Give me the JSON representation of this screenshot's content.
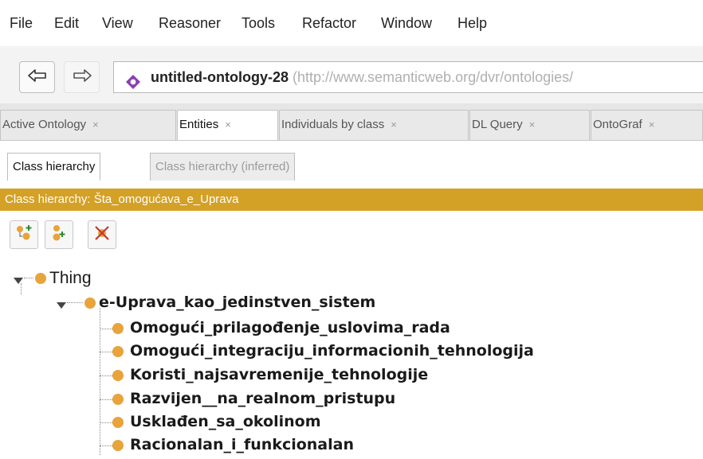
{
  "menu": [
    "File",
    "Edit",
    "View",
    "Reasoner",
    "Tools",
    "Refactor",
    "Window",
    "Help"
  ],
  "nav": {
    "back_icon": "back-arrow-icon",
    "forward_icon": "forward-arrow-icon",
    "ontology_icon": "ontology-diamond-icon",
    "ontology_name": "untitled-ontology-28",
    "ontology_url": "(http://www.semanticweb.org/dvr/ontologies/"
  },
  "workspace_tabs": [
    {
      "label": "Active Ontology",
      "close": "×"
    },
    {
      "label": "Entities",
      "close": "×"
    },
    {
      "label": "Individuals by class",
      "close": "×"
    },
    {
      "label": "DL Query",
      "close": "×"
    },
    {
      "label": "OntoGraf",
      "close": "×"
    }
  ],
  "sub_tabs": [
    "Class hierarchy",
    "Class hierarchy (inferred)"
  ],
  "view_header": "Class hierarchy: Šta_omogućava_e_Uprava",
  "toolbar": {
    "add_subclass_icon": "add-subclass-icon",
    "add_sibling_icon": "add-sibling-icon",
    "delete_class_icon": "delete-class-icon"
  },
  "tree": {
    "root": "Thing",
    "parent": "e-Uprava_kao_jedinstven_sistem",
    "children": [
      "Omogući_prilagođenje_uslovima_rada",
      "Omogući_integraciju_informacionih_tehnologija",
      "Koristi_najsavremenije_tehnologije",
      "Razvijen__na_realnom_pristupu",
      "Usklađen_sa_okolinom",
      "Racionalan_i_funkcionalan"
    ]
  },
  "colors": {
    "header_bar": "#d4a127",
    "class_dot": "#e8a33a",
    "ontology_icon": "#8a3fb0"
  }
}
